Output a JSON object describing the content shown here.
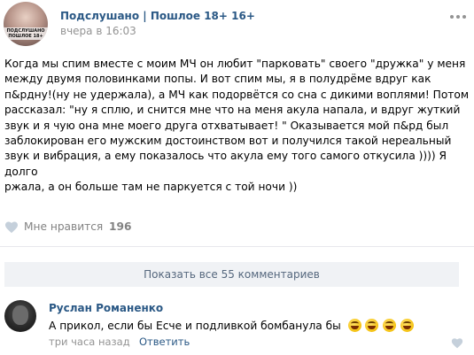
{
  "post": {
    "group_avatar_text": "ПОДСЛУШАНО ПОШЛОЕ 18+",
    "group_name": "Подслушано | Пошлое 18+ 16+",
    "time": "вчера в 16:03",
    "text_lines": [
      "Когда мы спим вместе с моим МЧ он любит \"парковать\" своего \"дружка\" у меня",
      "между двумя половинками попы. И вот спим мы, я в полудрёме вдруг как",
      "п&рдну!(ну не удержала), а МЧ как подорвётся со сна с дикими воплями! Потом",
      "рассказал: \"ну я сплю, и снится мне что на меня акула напала, и вдруг жуткий",
      "звук и я чую она мне моего друга отхватывает! \" Оказывается мой п&рд был",
      "заблокирован его мужским достоинством вот и получился такой нереальный",
      "звук и вибрация, а ему показалось что акула ему того самого откусила )))) Я долго",
      "ржала, а он больше там не паркуется с той ночи ))"
    ],
    "likes_label": "Мне нравится",
    "likes_count": "196",
    "more_icon": "more-dots-icon",
    "like_icon": "heart-icon"
  },
  "comments_block": {
    "show_all_label": "Показать все 55 комментариев"
  },
  "comment": {
    "author": "Руслан Романенко",
    "text": "А прикол, если бы Есче и подливкой бомбанула бы",
    "emoji_icons": [
      "laughing-emoji-icon",
      "laughing-emoji-icon",
      "laughing-emoji-icon",
      "laughing-emoji-icon"
    ],
    "time": "три часа назад",
    "reply_label": "Ответить",
    "like_icon": "heart-icon"
  },
  "colors": {
    "link_blue": "#2a5885",
    "meta_gray": "#939393",
    "button_bg": "#f0f2f5",
    "button_text": "#55677d"
  }
}
